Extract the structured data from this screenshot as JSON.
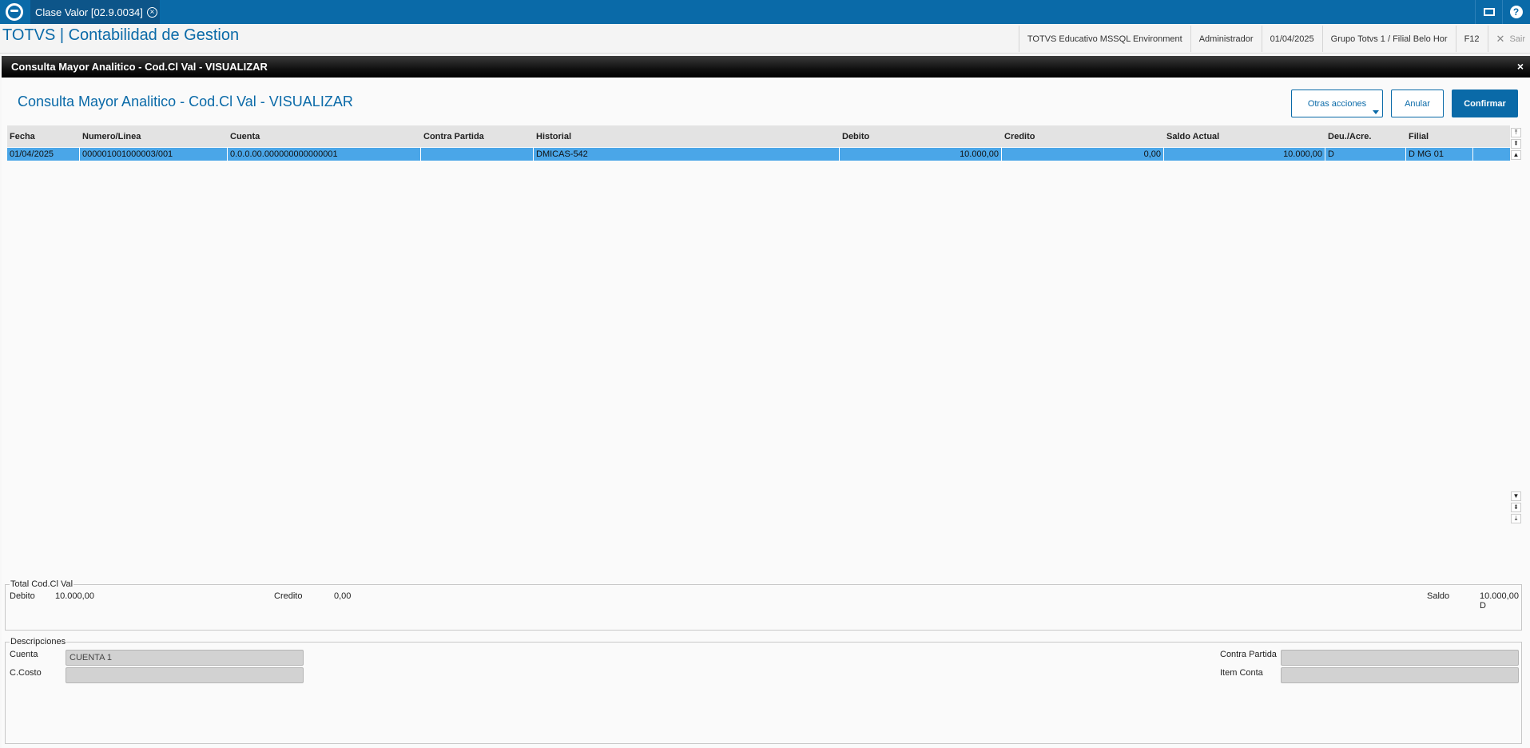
{
  "topbar": {
    "tab_label": "Clase Valor [02.9.0034]",
    "tab_close": "×",
    "mail_icon": "mail-icon",
    "help_label": "?"
  },
  "header": {
    "app_title": "TOTVS | Contabilidad de Gestion",
    "environment": "TOTVS Educativo MSSQL Environment",
    "user": "Administrador",
    "date": "01/04/2025",
    "branch": "Grupo Totvs 1 / Filial Belo Hor",
    "f12": "F12",
    "sair": "Sair",
    "sair_icon": "✕"
  },
  "dialog": {
    "title": "Consulta Mayor Analitico - Cod.Cl Val - VISUALIZAR",
    "close": "×",
    "view_title": "Consulta Mayor Analitico - Cod.Cl Val - VISUALIZAR",
    "buttons": {
      "otras": "Otras acciones",
      "anular": "Anular",
      "confirmar": "Confirmar"
    }
  },
  "grid": {
    "columns": [
      "Fecha",
      "Numero/Linea",
      "Cuenta",
      "Contra Partida",
      "Historial",
      "Debito",
      "Credito",
      "Saldo Actual",
      "Deu./Acre.",
      "Filial"
    ],
    "rows": [
      [
        "01/04/2025",
        "000001001000003/001",
        "0.0.0.00.000000000000001",
        "",
        "DMICAS-542",
        "10.000,00",
        "0,00",
        "10.000,00",
        "D",
        "D MG 01"
      ]
    ],
    "scroll_symbols": {
      "top": "⤒",
      "page_up": "⇞",
      "up": "▲",
      "down": "▼",
      "page_down": "⇟",
      "bottom": "⤓"
    }
  },
  "totals": {
    "legend": "Total Cod.Cl Val",
    "debito_label": "Debito",
    "debito_value": "10.000,00",
    "credito_label": "Credito",
    "credito_value": "0,00",
    "saldo_label": "Saldo",
    "saldo_value": "10.000,00 D"
  },
  "descriptions": {
    "legend": "Descripciones",
    "cuenta_label": "Cuenta",
    "cuenta_value": "CUENTA 1",
    "ccosto_label": "C.Costo",
    "ccosto_value": "",
    "contra_label": "Contra Partida",
    "contra_value": "",
    "item_label": "Item Conta",
    "item_value": ""
  }
}
